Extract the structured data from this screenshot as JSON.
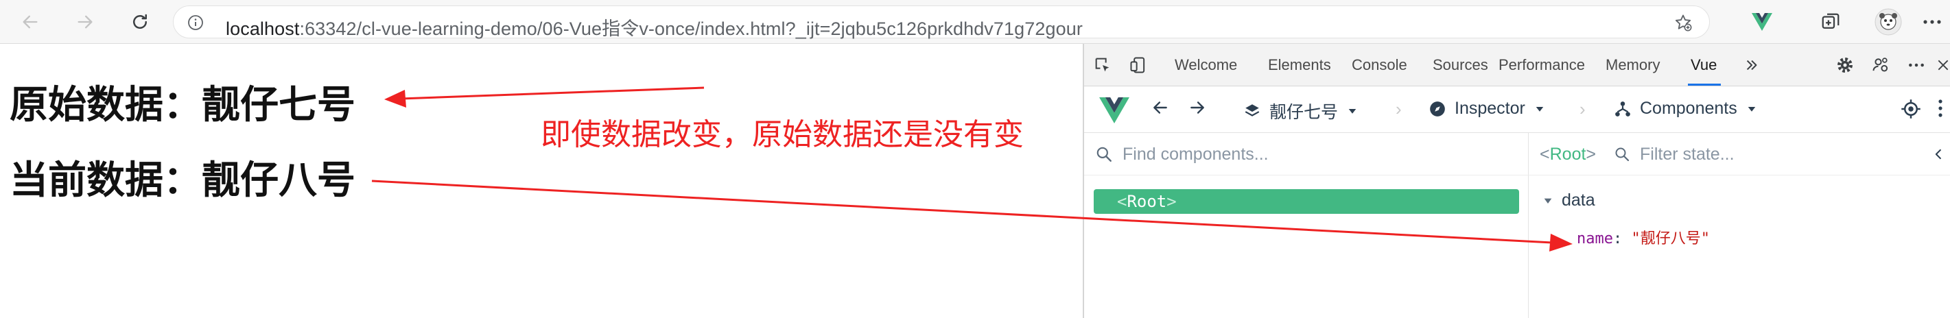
{
  "browser": {
    "url_host": "localhost",
    "url_rest": ":63342/cl-vue-learning-demo/06-Vue指令v-once/index.html?_ijt=2jqbu5c126prkdhdv71g72gour"
  },
  "page": {
    "original_label": "原始数据：靓仔七号",
    "current_label": "当前数据：靓仔八号",
    "annotation": "即使数据改变，原始数据还是没有变"
  },
  "devtools": {
    "tabs": [
      "Welcome",
      "Elements",
      "Console",
      "Sources",
      "Performance",
      "Memory",
      "Vue"
    ],
    "active_tab": "Vue",
    "vue": {
      "app_name": "靓仔七号",
      "inspector_label": "Inspector",
      "components_label": "Components",
      "find_placeholder": "Find components...",
      "root_node": "Root",
      "selected_component": "Root",
      "filter_placeholder": "Filter state...",
      "section": "data",
      "prop_key": "name",
      "prop_value": "\"靓仔八号\""
    }
  },
  "colors": {
    "vue_green": "#42b883",
    "annotation_red": "#ee2222",
    "active_tab_underline": "#1a73e8"
  }
}
